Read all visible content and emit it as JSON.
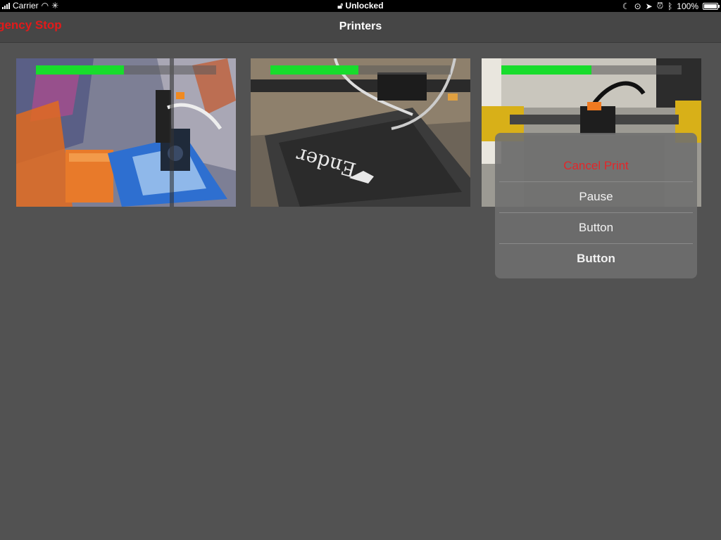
{
  "status_bar": {
    "carrier": "Carrier",
    "lock_text": "Unlocked",
    "battery": "100%"
  },
  "nav": {
    "title": "Printers",
    "emergency_stop": "ergency Stop"
  },
  "printers": [
    {
      "progress": 0.49,
      "scene": "enclosure-printer"
    },
    {
      "progress": 0.49,
      "scene": "ender-bed-printer"
    },
    {
      "progress": 0.5,
      "scene": "gantry-printer"
    }
  ],
  "action_sheet": {
    "cancel": "Cancel Print",
    "pause": "Pause",
    "button1": "Button",
    "button2": "Button"
  },
  "colors": {
    "background": "#525252",
    "nav_bar": "#464646",
    "progress": "#18dc2c",
    "emergency": "#e11a1a",
    "destructive": "#e3262a"
  }
}
